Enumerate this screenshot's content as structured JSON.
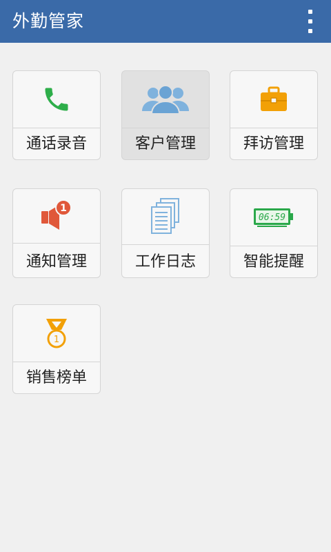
{
  "appbar": {
    "title": "外勤管家",
    "menu_icon": "overflow-menu-icon"
  },
  "tiles": [
    {
      "label": "通话录音",
      "icon": "phone-icon",
      "color": "#2eae4a"
    },
    {
      "label": "客户管理",
      "icon": "customers-icon",
      "color": "#7fb2dd",
      "pressed": true
    },
    {
      "label": "拜访管理",
      "icon": "briefcase-icon",
      "color": "#f2a007"
    },
    {
      "label": "通知管理",
      "icon": "megaphone-icon",
      "color": "#e0583a",
      "badge": "1"
    },
    {
      "label": "工作日志",
      "icon": "documents-icon",
      "color": "#7fb2dd"
    },
    {
      "label": "智能提醒",
      "icon": "digital-clock-icon",
      "color": "#2aa84a",
      "time": "06:59"
    },
    {
      "label": "销售榜单",
      "icon": "medal-icon",
      "color": "#f2a007",
      "medal_rank": "1"
    }
  ],
  "colors": {
    "appbar": "#3a6aa8",
    "background": "#f0f0f0"
  }
}
